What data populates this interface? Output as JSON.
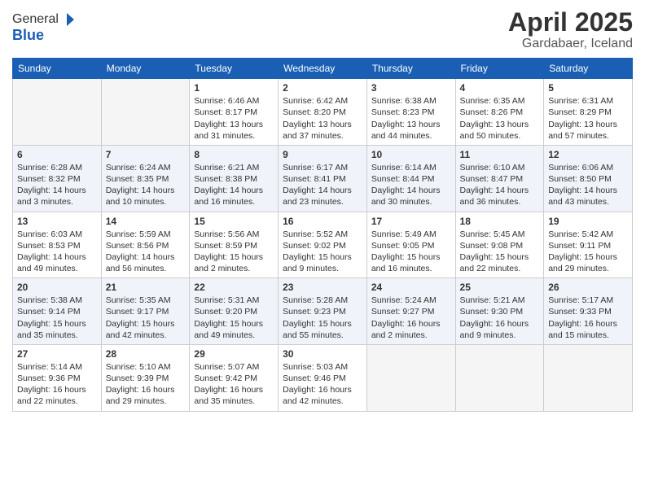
{
  "logo": {
    "general": "General",
    "blue": "Blue"
  },
  "title": "April 2025",
  "subtitle": "Gardabaer, Iceland",
  "weekdays": [
    "Sunday",
    "Monday",
    "Tuesday",
    "Wednesday",
    "Thursday",
    "Friday",
    "Saturday"
  ],
  "weeks": [
    [
      {
        "day": "",
        "empty": true
      },
      {
        "day": "",
        "empty": true
      },
      {
        "day": "1",
        "sunrise": "Sunrise: 6:46 AM",
        "sunset": "Sunset: 8:17 PM",
        "daylight": "Daylight: 13 hours and 31 minutes."
      },
      {
        "day": "2",
        "sunrise": "Sunrise: 6:42 AM",
        "sunset": "Sunset: 8:20 PM",
        "daylight": "Daylight: 13 hours and 37 minutes."
      },
      {
        "day": "3",
        "sunrise": "Sunrise: 6:38 AM",
        "sunset": "Sunset: 8:23 PM",
        "daylight": "Daylight: 13 hours and 44 minutes."
      },
      {
        "day": "4",
        "sunrise": "Sunrise: 6:35 AM",
        "sunset": "Sunset: 8:26 PM",
        "daylight": "Daylight: 13 hours and 50 minutes."
      },
      {
        "day": "5",
        "sunrise": "Sunrise: 6:31 AM",
        "sunset": "Sunset: 8:29 PM",
        "daylight": "Daylight: 13 hours and 57 minutes."
      }
    ],
    [
      {
        "day": "6",
        "sunrise": "Sunrise: 6:28 AM",
        "sunset": "Sunset: 8:32 PM",
        "daylight": "Daylight: 14 hours and 3 minutes."
      },
      {
        "day": "7",
        "sunrise": "Sunrise: 6:24 AM",
        "sunset": "Sunset: 8:35 PM",
        "daylight": "Daylight: 14 hours and 10 minutes."
      },
      {
        "day": "8",
        "sunrise": "Sunrise: 6:21 AM",
        "sunset": "Sunset: 8:38 PM",
        "daylight": "Daylight: 14 hours and 16 minutes."
      },
      {
        "day": "9",
        "sunrise": "Sunrise: 6:17 AM",
        "sunset": "Sunset: 8:41 PM",
        "daylight": "Daylight: 14 hours and 23 minutes."
      },
      {
        "day": "10",
        "sunrise": "Sunrise: 6:14 AM",
        "sunset": "Sunset: 8:44 PM",
        "daylight": "Daylight: 14 hours and 30 minutes."
      },
      {
        "day": "11",
        "sunrise": "Sunrise: 6:10 AM",
        "sunset": "Sunset: 8:47 PM",
        "daylight": "Daylight: 14 hours and 36 minutes."
      },
      {
        "day": "12",
        "sunrise": "Sunrise: 6:06 AM",
        "sunset": "Sunset: 8:50 PM",
        "daylight": "Daylight: 14 hours and 43 minutes."
      }
    ],
    [
      {
        "day": "13",
        "sunrise": "Sunrise: 6:03 AM",
        "sunset": "Sunset: 8:53 PM",
        "daylight": "Daylight: 14 hours and 49 minutes."
      },
      {
        "day": "14",
        "sunrise": "Sunrise: 5:59 AM",
        "sunset": "Sunset: 8:56 PM",
        "daylight": "Daylight: 14 hours and 56 minutes."
      },
      {
        "day": "15",
        "sunrise": "Sunrise: 5:56 AM",
        "sunset": "Sunset: 8:59 PM",
        "daylight": "Daylight: 15 hours and 2 minutes."
      },
      {
        "day": "16",
        "sunrise": "Sunrise: 5:52 AM",
        "sunset": "Sunset: 9:02 PM",
        "daylight": "Daylight: 15 hours and 9 minutes."
      },
      {
        "day": "17",
        "sunrise": "Sunrise: 5:49 AM",
        "sunset": "Sunset: 9:05 PM",
        "daylight": "Daylight: 15 hours and 16 minutes."
      },
      {
        "day": "18",
        "sunrise": "Sunrise: 5:45 AM",
        "sunset": "Sunset: 9:08 PM",
        "daylight": "Daylight: 15 hours and 22 minutes."
      },
      {
        "day": "19",
        "sunrise": "Sunrise: 5:42 AM",
        "sunset": "Sunset: 9:11 PM",
        "daylight": "Daylight: 15 hours and 29 minutes."
      }
    ],
    [
      {
        "day": "20",
        "sunrise": "Sunrise: 5:38 AM",
        "sunset": "Sunset: 9:14 PM",
        "daylight": "Daylight: 15 hours and 35 minutes."
      },
      {
        "day": "21",
        "sunrise": "Sunrise: 5:35 AM",
        "sunset": "Sunset: 9:17 PM",
        "daylight": "Daylight: 15 hours and 42 minutes."
      },
      {
        "day": "22",
        "sunrise": "Sunrise: 5:31 AM",
        "sunset": "Sunset: 9:20 PM",
        "daylight": "Daylight: 15 hours and 49 minutes."
      },
      {
        "day": "23",
        "sunrise": "Sunrise: 5:28 AM",
        "sunset": "Sunset: 9:23 PM",
        "daylight": "Daylight: 15 hours and 55 minutes."
      },
      {
        "day": "24",
        "sunrise": "Sunrise: 5:24 AM",
        "sunset": "Sunset: 9:27 PM",
        "daylight": "Daylight: 16 hours and 2 minutes."
      },
      {
        "day": "25",
        "sunrise": "Sunrise: 5:21 AM",
        "sunset": "Sunset: 9:30 PM",
        "daylight": "Daylight: 16 hours and 9 minutes."
      },
      {
        "day": "26",
        "sunrise": "Sunrise: 5:17 AM",
        "sunset": "Sunset: 9:33 PM",
        "daylight": "Daylight: 16 hours and 15 minutes."
      }
    ],
    [
      {
        "day": "27",
        "sunrise": "Sunrise: 5:14 AM",
        "sunset": "Sunset: 9:36 PM",
        "daylight": "Daylight: 16 hours and 22 minutes."
      },
      {
        "day": "28",
        "sunrise": "Sunrise: 5:10 AM",
        "sunset": "Sunset: 9:39 PM",
        "daylight": "Daylight: 16 hours and 29 minutes."
      },
      {
        "day": "29",
        "sunrise": "Sunrise: 5:07 AM",
        "sunset": "Sunset: 9:42 PM",
        "daylight": "Daylight: 16 hours and 35 minutes."
      },
      {
        "day": "30",
        "sunrise": "Sunrise: 5:03 AM",
        "sunset": "Sunset: 9:46 PM",
        "daylight": "Daylight: 16 hours and 42 minutes."
      },
      {
        "day": "",
        "empty": true
      },
      {
        "day": "",
        "empty": true
      },
      {
        "day": "",
        "empty": true
      }
    ]
  ]
}
